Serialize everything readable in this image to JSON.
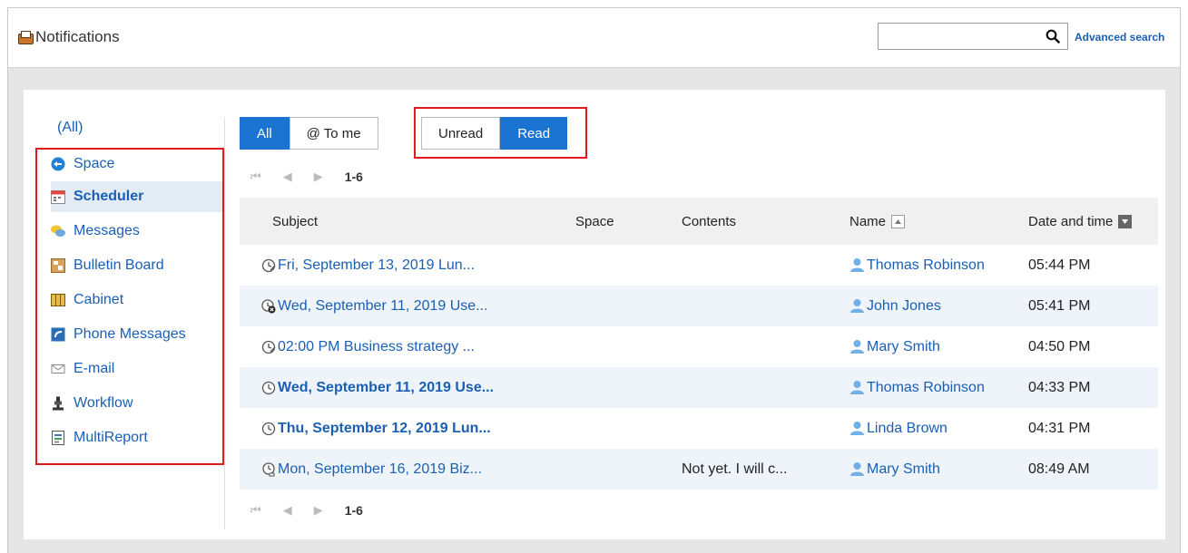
{
  "header": {
    "title": "Notifications",
    "search_placeholder": "",
    "advanced_search": "Advanced search"
  },
  "sidebar": {
    "all": "(All)",
    "items": [
      {
        "label": "Space",
        "icon": "space-icon"
      },
      {
        "label": "Scheduler",
        "icon": "scheduler-icon",
        "active": true
      },
      {
        "label": "Messages",
        "icon": "messages-icon"
      },
      {
        "label": "Bulletin Board",
        "icon": "bulletin-board-icon"
      },
      {
        "label": "Cabinet",
        "icon": "cabinet-icon"
      },
      {
        "label": "Phone Messages",
        "icon": "phone-messages-icon"
      },
      {
        "label": "E-mail",
        "icon": "email-icon"
      },
      {
        "label": "Workflow",
        "icon": "workflow-icon"
      },
      {
        "label": "MultiReport",
        "icon": "multireport-icon"
      }
    ]
  },
  "filters": {
    "all": "All",
    "to_me": "@ To me",
    "unread": "Unread",
    "read": "Read"
  },
  "pager": {
    "first": "⏮",
    "prev": "◀",
    "next": "▶",
    "range": "1-6"
  },
  "table": {
    "headers": {
      "subject": "Subject",
      "space": "Space",
      "contents": "Contents",
      "name": "Name",
      "date": "Date and time"
    },
    "rows": [
      {
        "subject": "Fri, September 13, 2019 Lun...",
        "space": "",
        "contents": "",
        "name": "Thomas Robinson",
        "date": "05:44 PM",
        "bold": false
      },
      {
        "subject": "Wed, September 11, 2019 Use...",
        "space": "",
        "contents": "",
        "name": "John Jones",
        "date": "05:41 PM",
        "bold": false
      },
      {
        "subject": "02:00 PM Business strategy ...",
        "space": "",
        "contents": "",
        "name": "Mary Smith",
        "date": "04:50 PM",
        "bold": false
      },
      {
        "subject": "Wed, September 11, 2019 Use...",
        "space": "",
        "contents": "",
        "name": "Thomas Robinson",
        "date": "04:33 PM",
        "bold": true
      },
      {
        "subject": "Thu, September 12, 2019 Lun...",
        "space": "",
        "contents": "",
        "name": "Linda Brown",
        "date": "04:31 PM",
        "bold": true
      },
      {
        "subject": "Mon, September 16, 2019 Biz...",
        "space": "",
        "contents": "Not yet. I will c...",
        "name": "Mary Smith",
        "date": "08:49 AM",
        "bold": false
      }
    ]
  },
  "colors": {
    "accent": "#1a73d1",
    "link": "#1a5fb4",
    "highlight": "#e31a1c",
    "row_alt": "#eef4fa"
  }
}
